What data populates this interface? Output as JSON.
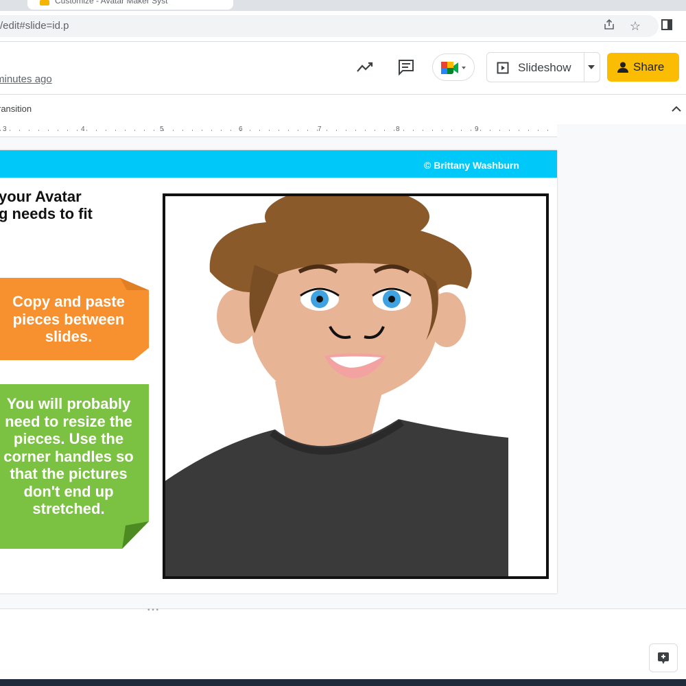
{
  "browser": {
    "tab_title": "Customize - Avatar Maker Syst",
    "url": "/edit#slide=id.p"
  },
  "header": {
    "last_edit": "minutes ago",
    "slideshow_label": "Slideshow",
    "share_label": "Share"
  },
  "toolbar": {
    "transition_label": "ransition"
  },
  "ruler": {
    "numbers": [
      "3",
      "4",
      "5",
      "6",
      "7",
      "8",
      "9"
    ]
  },
  "slide": {
    "copyright": "© Brittany Washburn",
    "instructions": [
      "your Avatar",
      "g needs to fit"
    ],
    "orange_note": [
      "Copy and paste",
      "pieces between",
      "slides."
    ],
    "green_note": [
      "You will probably",
      "need to resize the",
      "pieces. Use the",
      "corner handles so",
      "that the pictures",
      "don't end up",
      "stretched."
    ]
  },
  "colors": {
    "banner": "#00c8f8",
    "orange_note": "#f7902e",
    "green_note": "#7cc242",
    "share": "#fbbc04",
    "hair": "#8a5a2b",
    "skin": "#e8b496",
    "shirt": "#3a3a3a",
    "eyes": "#3ea3e0"
  },
  "icons": [
    "share-page-icon",
    "star-icon",
    "side-panel-icon",
    "activity-icon",
    "comment-icon",
    "meet-icon",
    "present-icon",
    "person-icon",
    "chevron-up-icon",
    "explore-icon"
  ]
}
